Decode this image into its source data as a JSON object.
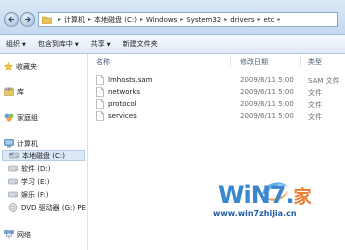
{
  "address": {
    "crumbs": [
      "计算机",
      "本地磁盘 (C:)",
      "Windows",
      "System32",
      "drivers",
      "etc"
    ]
  },
  "toolbar": {
    "organize": "组织",
    "include_in_library": "包含到库中",
    "share": "共享",
    "new_folder": "新建文件夹"
  },
  "navpane": {
    "favorites": "收藏夹",
    "library": "库",
    "homegroup": "家庭组",
    "computer": "计算机",
    "drive_c": "本地磁盘 (C:)",
    "drive_d": "软件 (D:)",
    "drive_e": "学习 (E:)",
    "drive_f": "娱乐 (F:)",
    "drive_g": "DVD 驱动器 (G:) PE",
    "network": "网络"
  },
  "list": {
    "headers": {
      "name": "名称",
      "date": "修改日期",
      "type": "类型"
    },
    "files": [
      {
        "name": "lmhosts.sam",
        "date": "2009/6/11 5:00",
        "type": "SAM 文件"
      },
      {
        "name": "networks",
        "date": "2009/6/11 5:00",
        "type": "文件"
      },
      {
        "name": "protocol",
        "date": "2009/6/11 5:00",
        "type": "文件"
      },
      {
        "name": "services",
        "date": "2009/6/11 5:00",
        "type": "文件"
      }
    ]
  },
  "watermark": {
    "logo_text": "WiN7.",
    "logo_suffix": "家",
    "url": "www.win7zhijia.cn"
  },
  "colors": {
    "accent": "#3a86cf",
    "watermark_orange": "#ee7a2a",
    "chrome": "#dce9f7"
  },
  "icons": {
    "back": "back-arrow-icon",
    "forward": "forward-arrow-icon",
    "favorites": "star-icon",
    "library": "library-icon",
    "homegroup": "homegroup-icon",
    "computer": "computer-icon",
    "drive": "hard-drive-icon",
    "dvd": "dvd-drive-icon",
    "network": "network-icon",
    "file": "file-icon"
  }
}
